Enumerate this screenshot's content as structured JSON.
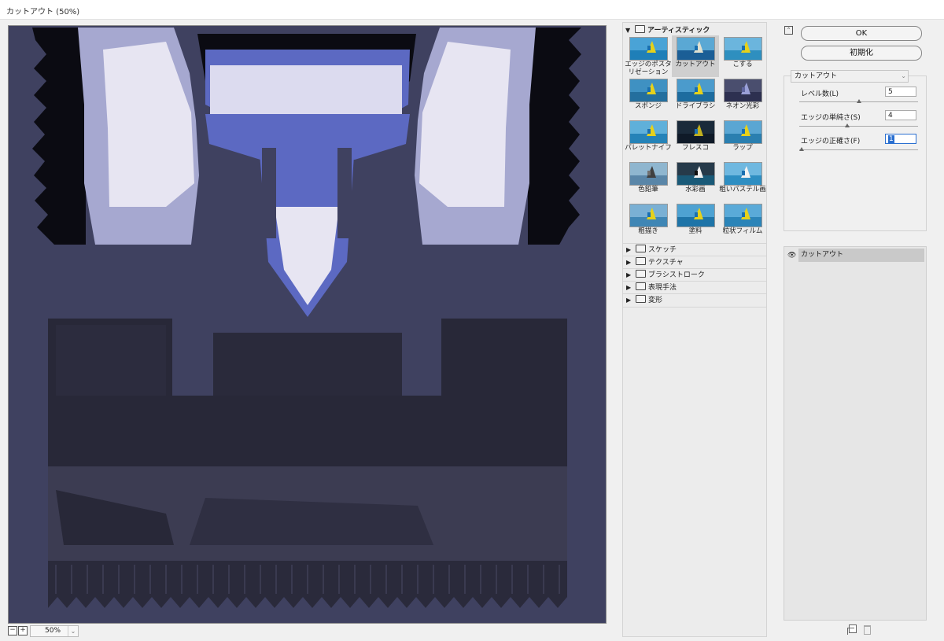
{
  "window": {
    "title": "カットアウト (50%)"
  },
  "zoom": {
    "out_symbol": "−",
    "in_symbol": "+",
    "value": "50%"
  },
  "gallery": {
    "category": "アーティスティック",
    "items": [
      {
        "label": "エッジのポスタリゼーション",
        "selected": false
      },
      {
        "label": "カットアウト",
        "selected": true
      },
      {
        "label": "こする",
        "selected": false
      },
      {
        "label": "スポンジ",
        "selected": false
      },
      {
        "label": "ドライブラシ",
        "selected": false
      },
      {
        "label": "ネオン光彩",
        "selected": false
      },
      {
        "label": "パレットナイフ",
        "selected": false
      },
      {
        "label": "フレスコ",
        "selected": false
      },
      {
        "label": "ラップ",
        "selected": false
      },
      {
        "label": "色鉛筆",
        "selected": false
      },
      {
        "label": "水彩画",
        "selected": false
      },
      {
        "label": "粗いパステル画",
        "selected": false
      },
      {
        "label": "粗描き",
        "selected": false
      },
      {
        "label": "塗料",
        "selected": false
      },
      {
        "label": "粒状フィルム",
        "selected": false
      }
    ],
    "subcategories": [
      "スケッチ",
      "テクスチャ",
      "ブラシストローク",
      "表現手法",
      "変形"
    ]
  },
  "buttons": {
    "ok": "OK",
    "reset": "初期化"
  },
  "filter_select": {
    "value": "カットアウト"
  },
  "params": [
    {
      "label": "レベル数(L)",
      "value": "5",
      "slider": 0.5
    },
    {
      "label": "エッジの単純さ(S)",
      "value": "4",
      "slider": 0.4
    },
    {
      "label": "エッジの正確さ(F)",
      "value": "1",
      "slider": 0.0
    }
  ],
  "layers": [
    {
      "name": "カットアウト",
      "visible": true
    }
  ],
  "colors": {
    "canvas_bg": "#3f4160",
    "accent": "#2a6fd0"
  }
}
